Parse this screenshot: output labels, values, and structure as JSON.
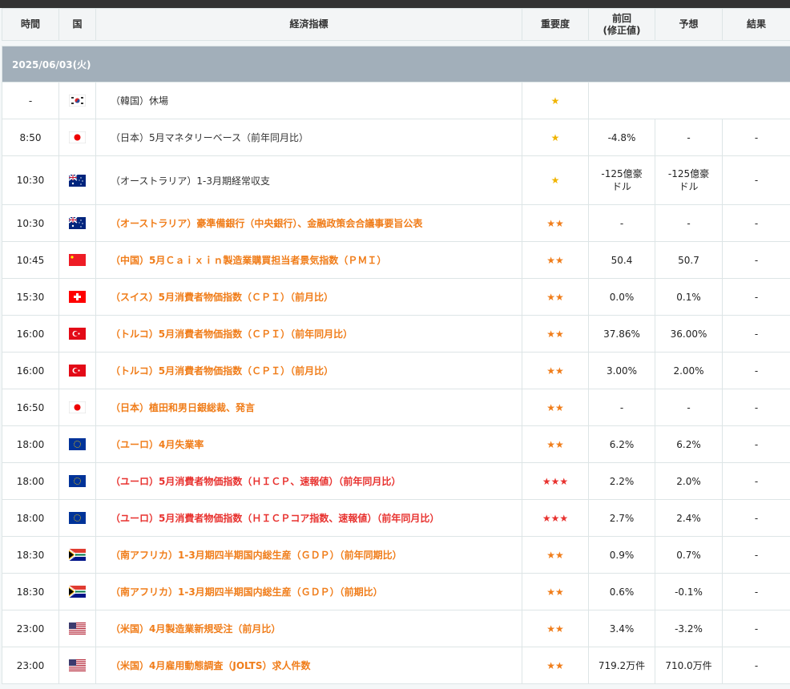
{
  "header": {
    "time": "時間",
    "country": "国",
    "indicator": "経済指標",
    "importance": "重要度",
    "previous_line1": "前回",
    "previous_line2": "(修正値)",
    "forecast": "予想",
    "result": "結果"
  },
  "date": "2025/06/03(火)",
  "colors": {
    "level1": "#333333",
    "level2": "#f07d1a",
    "level3": "#e8322f",
    "star1": "#f0b400"
  },
  "rows": [
    {
      "time": "-",
      "flag": "kr",
      "event": "（韓国）休場",
      "level": 1,
      "stars": "★",
      "prev": "",
      "fc": "",
      "res": "",
      "merged": true
    },
    {
      "time": "8:50",
      "flag": "jp",
      "event": "（日本）5月マネタリーベース（前年同月比）",
      "level": 1,
      "stars": "★",
      "prev": "-4.8%",
      "fc": "-",
      "res": "-"
    },
    {
      "time": "10:30",
      "flag": "au",
      "event": "（オーストラリア）1-3月期経常収支",
      "level": 1,
      "stars": "★",
      "prev": "-125億豪ドル",
      "fc": "-125億豪ドル",
      "res": "-",
      "tall": true
    },
    {
      "time": "10:30",
      "flag": "au",
      "event": "（オーストラリア）豪準備銀行（中央銀行）、金融政策会合議事要旨公表",
      "level": 2,
      "stars": "★★",
      "prev": "-",
      "fc": "-",
      "res": "-"
    },
    {
      "time": "10:45",
      "flag": "cn",
      "event": "（中国）5月Ｃａｉｘｉｎ製造業購買担当者景気指数（ＰＭＩ）",
      "level": 2,
      "stars": "★★",
      "prev": "50.4",
      "fc": "50.7",
      "res": "-"
    },
    {
      "time": "15:30",
      "flag": "ch",
      "event": "（スイス）5月消費者物価指数（ＣＰＩ）（前月比）",
      "level": 2,
      "stars": "★★",
      "prev": "0.0%",
      "fc": "0.1%",
      "res": "-"
    },
    {
      "time": "16:00",
      "flag": "tr",
      "event": "（トルコ）5月消費者物価指数（ＣＰＩ）（前年同月比）",
      "level": 2,
      "stars": "★★",
      "prev": "37.86%",
      "fc": "36.00%",
      "res": "-"
    },
    {
      "time": "16:00",
      "flag": "tr",
      "event": "（トルコ）5月消費者物価指数（ＣＰＩ）（前月比）",
      "level": 2,
      "stars": "★★",
      "prev": "3.00%",
      "fc": "2.00%",
      "res": "-"
    },
    {
      "time": "16:50",
      "flag": "jp",
      "event": "（日本）植田和男日銀総裁、発言",
      "level": 2,
      "stars": "★★",
      "prev": "-",
      "fc": "-",
      "res": "-"
    },
    {
      "time": "18:00",
      "flag": "eu",
      "event": "（ユーロ）4月失業率",
      "level": 2,
      "stars": "★★",
      "prev": "6.2%",
      "fc": "6.2%",
      "res": "-"
    },
    {
      "time": "18:00",
      "flag": "eu",
      "event": "（ユーロ）5月消費者物価指数（ＨＩＣＰ、速報値）（前年同月比）",
      "level": 3,
      "stars": "★★★",
      "prev": "2.2%",
      "fc": "2.0%",
      "res": "-"
    },
    {
      "time": "18:00",
      "flag": "eu",
      "event": "（ユーロ）5月消費者物価指数（ＨＩＣＰコア指数、速報値）（前年同月比）",
      "level": 3,
      "stars": "★★★",
      "prev": "2.7%",
      "fc": "2.4%",
      "res": "-"
    },
    {
      "time": "18:30",
      "flag": "za",
      "event": "（南アフリカ）1-3月期四半期国内総生産（ＧＤＰ）（前年同期比）",
      "level": 2,
      "stars": "★★",
      "prev": "0.9%",
      "fc": "0.7%",
      "res": "-"
    },
    {
      "time": "18:30",
      "flag": "za",
      "event": "（南アフリカ）1-3月期四半期国内総生産（ＧＤＰ）（前期比）",
      "level": 2,
      "stars": "★★",
      "prev": "0.6%",
      "fc": "-0.1%",
      "res": "-"
    },
    {
      "time": "23:00",
      "flag": "us",
      "event": "（米国）4月製造業新規受注（前月比）",
      "level": 2,
      "stars": "★★",
      "prev": "3.4%",
      "fc": "-3.2%",
      "res": "-"
    },
    {
      "time": "23:00",
      "flag": "us",
      "event": "（米国）4月雇用動態調査（JOLTS）求人件数",
      "level": 2,
      "stars": "★★",
      "prev": "719.2万件",
      "fc": "710.0万件",
      "res": "-"
    }
  ]
}
